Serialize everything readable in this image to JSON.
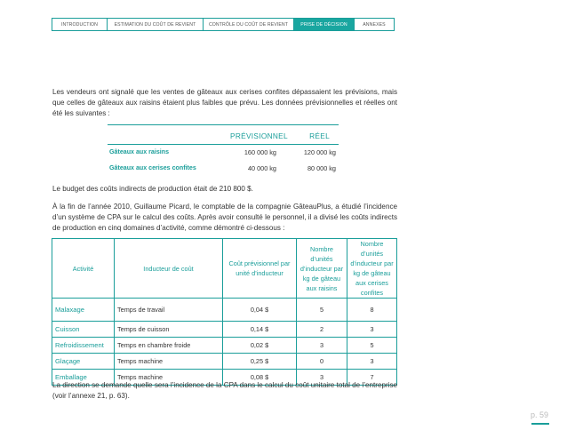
{
  "nav": {
    "tabs": [
      "INTRODUCTION",
      "ESTIMATION DU COÛT DE REVIENT",
      "CONTRÔLE DU COÛT DE REVIENT",
      "PRISE DE DÉCISION",
      "ANNEXES"
    ]
  },
  "text": {
    "para1": "Les vendeurs ont signalé que les ventes de gâteaux aux cerises confites dépassaient les prévisions, mais que celles de gâteaux aux raisins étaient plus faibles que prévu. Les données prévisionnelles et réelles ont été les suivantes :",
    "para2": "Le budget des coûts indirects de production était de 210 800 $.",
    "para3": "À la fin de l’année 2010, Guillaume Picard, le comptable de la compagnie GâteauPlus, a étudié l’incidence d’un système de CPA sur le calcul des coûts. Après avoir consulté le personnel, il a divisé les coûts indirects de production en cinq domaines d’activité, comme démontré ci-dessous :",
    "para4": "La direction se demande quelle sera l’incidence de la CPA dans le calcul du coût unitaire total de l’entreprise (voir l’annexe 21, p. 63)."
  },
  "forecast": {
    "col_prev": "PRÉVISIONNEL",
    "col_reel": "RÉEL",
    "rows": [
      {
        "label": "Gâteaux aux raisins",
        "prev": "160 000 kg",
        "reel": "120 000 kg"
      },
      {
        "label": "Gâteaux aux cerises confites",
        "prev": "40 000 kg",
        "reel": "80 000 kg"
      }
    ]
  },
  "activity_table": {
    "headers": [
      "Activité",
      "Inducteur de coût",
      "Coût prévisionnel par unité d’inducteur",
      "Nombre d’unités d’inducteur par kg de gâteau aux raisins",
      "Nombre d’unités d’inducteur par kg de gâteau aux cerises confites"
    ],
    "rows": [
      [
        "Malaxage",
        "Temps de travail",
        "0,04 $",
        "5",
        "8"
      ],
      [
        "Cuisson",
        "Temps de cuisson",
        "0,14 $",
        "2",
        "3"
      ],
      [
        "Refroidissement",
        "Temps en chambre froide",
        "0,02 $",
        "3",
        "5"
      ],
      [
        "Glaçage",
        "Temps machine",
        "0,25 $",
        "0",
        "3"
      ],
      [
        "Emballage",
        "Temps machine",
        "0,08 $",
        "3",
        "7"
      ]
    ]
  },
  "footer": {
    "page": "p. 59"
  },
  "colors": {
    "accent": "#1a9e9a"
  }
}
